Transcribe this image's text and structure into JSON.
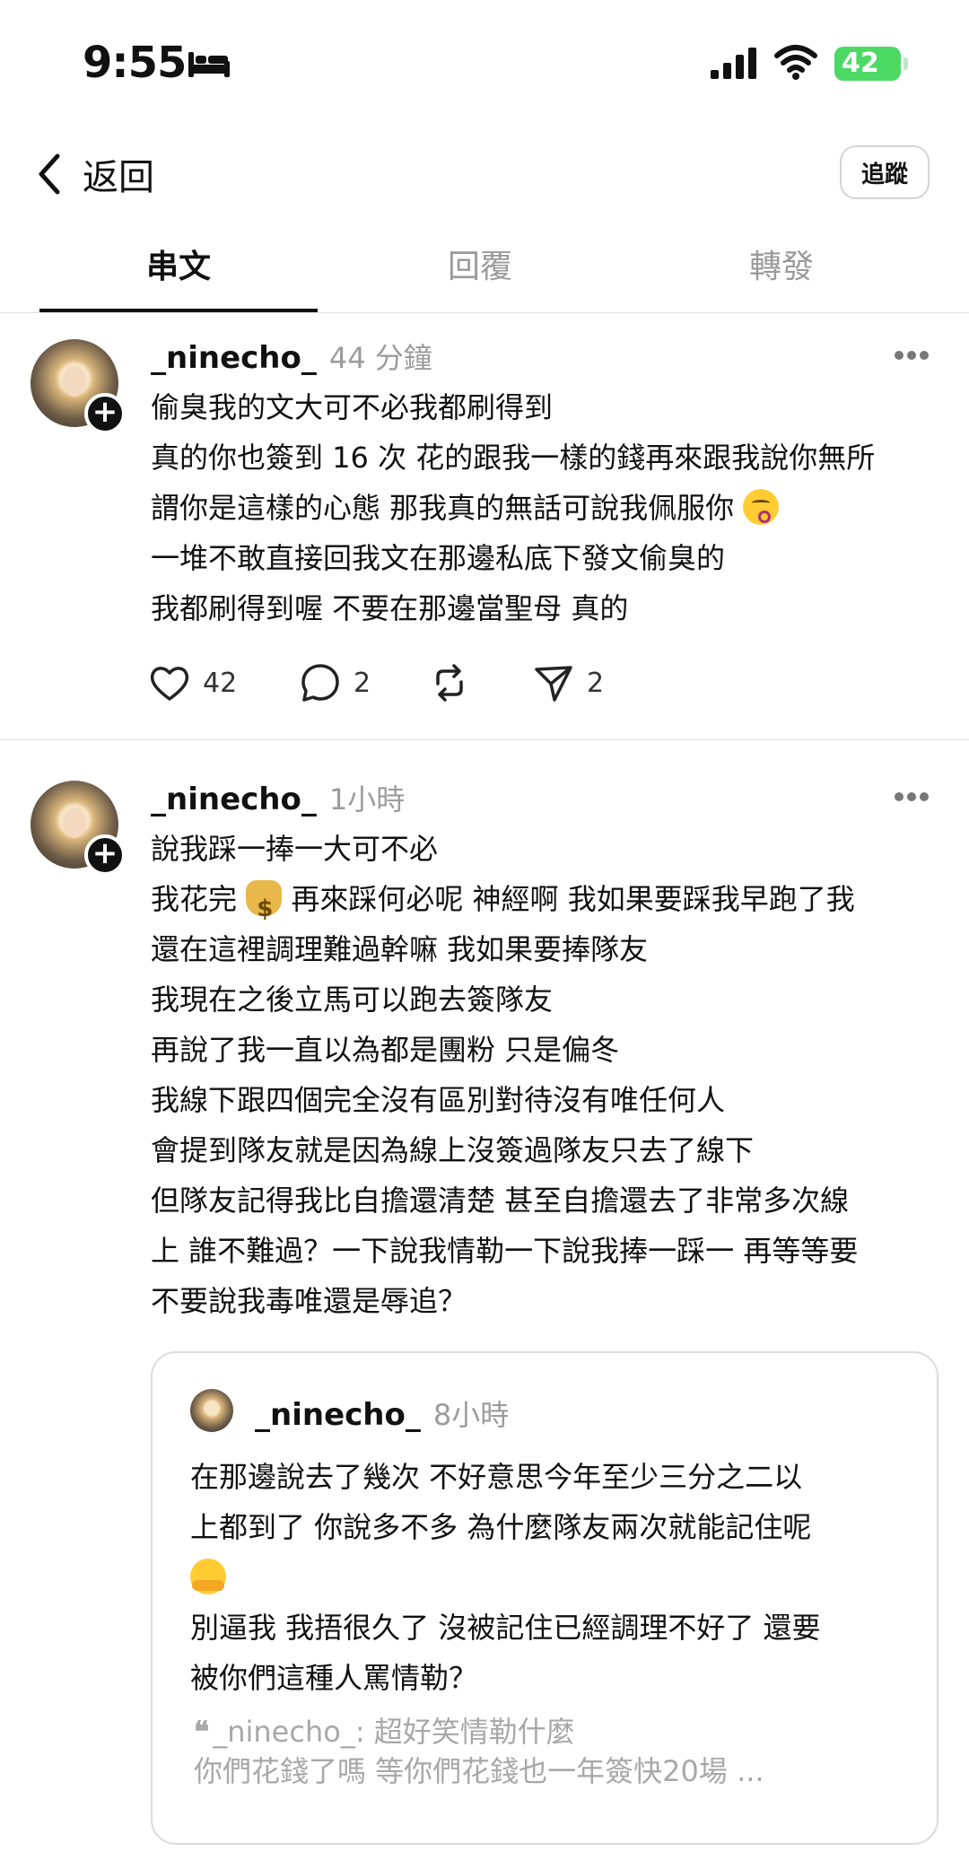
{
  "status_bar": {
    "time": "9:55",
    "battery": "42"
  },
  "header": {
    "back_label": "返回",
    "follow_label": "追蹤"
  },
  "tabs": [
    {
      "label": "串文",
      "active": true
    },
    {
      "label": "回覆",
      "active": false
    },
    {
      "label": "轉發",
      "active": false
    }
  ],
  "posts": [
    {
      "author": "_ninecho_",
      "time": "44 分鐘",
      "lines": [
        "偷臭我的文大可不必我都刷得到",
        "真的你也簽到 16 次 花的跟我一樣的錢再來跟我說你無所",
        "謂你是這樣的心態 那我真的無話可說我佩服你",
        "一堆不敢直接回我文在那邊私底下發文偷臭的",
        "我都刷得到喔 不要在那邊當聖母 真的"
      ],
      "emoji": "kissing-face-emoji",
      "likes": "42",
      "comments": "2",
      "shares": "2"
    },
    {
      "author": "_ninecho_",
      "time": "1小時",
      "lines": [
        "說我踩一捧一大可不必",
        "我花完 __BAG__ 再來踩何必呢 神經啊 我如果要踩我早跑了我",
        "還在這裡調理難過幹嘛 我如果要捧隊友",
        "我現在之後立馬可以跑去簽隊友",
        "再說了我一直以為都是團粉 只是偏冬",
        "我線下跟四個完全沒有區別對待沒有唯任何人",
        "會提到隊友就是因為線上沒簽過隊友只去了線下",
        "但隊友記得我比自擔還清楚 甚至自擔還去了非常多次線",
        "上 誰不難過？一下說我情勒一下說我捧一踩一 再等等要",
        "不要說我毒唯還是辱追？"
      ],
      "emoji": "money-bag-emoji",
      "quote": {
        "author": "_ninecho_",
        "time": "8小時",
        "lines": [
          "在那邊說去了幾次 不好意思今年至少三分之二以",
          "上都到了 你說多不多 為什麼隊友兩次就能記住呢",
          "",
          "別逼我 我捂很久了 沒被記住已經調理不好了 還要",
          "被你們這種人罵情勒？"
        ],
        "emoji": "hugging-face-emoji",
        "reply_prefix": "_ninecho_: 超好笑情勒什麼",
        "reply_line2": "你們花錢了嗎 等你們花錢也一年簽快20場 ..."
      }
    }
  ]
}
